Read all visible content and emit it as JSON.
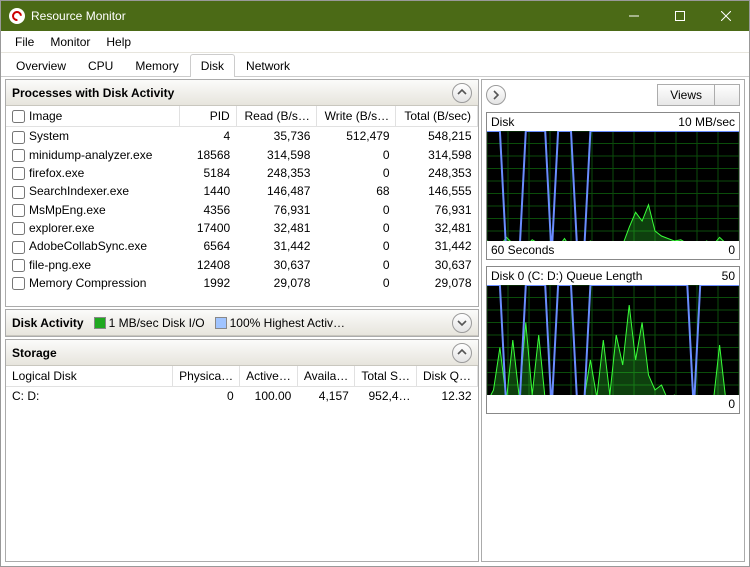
{
  "window": {
    "title": "Resource Monitor"
  },
  "menu": [
    "File",
    "Monitor",
    "Help"
  ],
  "tabs": {
    "items": [
      "Overview",
      "CPU",
      "Memory",
      "Disk",
      "Network"
    ],
    "active": 3
  },
  "panels": {
    "processes": {
      "title": "Processes with Disk Activity",
      "columns": [
        "Image",
        "PID",
        "Read (B/s…",
        "Write (B/s…",
        "Total (B/sec)"
      ],
      "rows": [
        {
          "image": "System",
          "pid": "4",
          "read": "35,736",
          "write": "512,479",
          "total": "548,215"
        },
        {
          "image": "minidump-analyzer.exe",
          "pid": "18568",
          "read": "314,598",
          "write": "0",
          "total": "314,598"
        },
        {
          "image": "firefox.exe",
          "pid": "5184",
          "read": "248,353",
          "write": "0",
          "total": "248,353"
        },
        {
          "image": "SearchIndexer.exe",
          "pid": "1440",
          "read": "146,487",
          "write": "68",
          "total": "146,555"
        },
        {
          "image": "MsMpEng.exe",
          "pid": "4356",
          "read": "76,931",
          "write": "0",
          "total": "76,931"
        },
        {
          "image": "explorer.exe",
          "pid": "17400",
          "read": "32,481",
          "write": "0",
          "total": "32,481"
        },
        {
          "image": "AdobeCollabSync.exe",
          "pid": "6564",
          "read": "31,442",
          "write": "0",
          "total": "31,442"
        },
        {
          "image": "file-png.exe",
          "pid": "12408",
          "read": "30,637",
          "write": "0",
          "total": "30,637"
        },
        {
          "image": "Memory Compression",
          "pid": "1992",
          "read": "29,078",
          "write": "0",
          "total": "29,078"
        }
      ]
    },
    "activity": {
      "title": "Disk Activity",
      "legend1_color": "#1fa81f",
      "legend1_text": "1 MB/sec Disk I/O",
      "legend2_color": "#a0c4ff",
      "legend2_text": "100% Highest Active T…"
    },
    "storage": {
      "title": "Storage",
      "columns": [
        "Logical Disk",
        "Physica…",
        "Active…",
        "Availa…",
        "Total S…",
        "Disk Q…"
      ],
      "rows": [
        {
          "c0": "C: D:",
          "c1": "0",
          "c2": "100.00",
          "c3": "4,157",
          "c4": "952,4…",
          "c5": "12.32"
        }
      ]
    }
  },
  "right": {
    "views_label": "Views",
    "charts": [
      {
        "title": "Disk",
        "right": "10 MB/sec",
        "foot_left": "60 Seconds",
        "foot_right": "0",
        "height": 125
      },
      {
        "title": "Disk 0 (C: D:) Queue Length",
        "right": "50",
        "foot_left": "",
        "foot_right": "0",
        "height": 125
      }
    ]
  },
  "chart_data": [
    {
      "type": "line",
      "title": "Disk",
      "ylabel": "MB/sec",
      "ylim": [
        0,
        10
      ],
      "xlim_seconds": [
        60,
        0
      ],
      "series": [
        {
          "name": "Disk I/O",
          "color": "#39ff39",
          "values": [
            1.2,
            1.0,
            0.8,
            1.5,
            1.0,
            0.6,
            0.8,
            1.3,
            1.0,
            0.8,
            1.0,
            0.7,
            1.4,
            0.6,
            0.7,
            0.9,
            1.2,
            0.8,
            1.0,
            0.6,
            0.7,
            0.9,
            2.3,
            3.5,
            2.8,
            4.1,
            2.0,
            1.6,
            1.4,
            1.2,
            1.3,
            1.0,
            1.1,
            0.9,
            1.2,
            0.9,
            1.5,
            1.0,
            0.8,
            0.6
          ]
        },
        {
          "name": "Highest Active Time %",
          "color": "#6a8dff",
          "ylim": [
            0,
            100
          ],
          "values": [
            100,
            100,
            100,
            0,
            0,
            0,
            100,
            100,
            100,
            100,
            0,
            100,
            100,
            100,
            0,
            0,
            100,
            100,
            100,
            100,
            100,
            100,
            100,
            100,
            100,
            100,
            100,
            100,
            100,
            100,
            100,
            100,
            100,
            100,
            100,
            100,
            100,
            100,
            100,
            100
          ]
        }
      ]
    },
    {
      "type": "line",
      "title": "Disk 0 (C: D:) Queue Length",
      "ylim": [
        0,
        50
      ],
      "xlim_seconds": [
        60,
        0
      ],
      "series": [
        {
          "name": "Queue Length",
          "color": "#39ff39",
          "values": [
            3,
            8,
            25,
            4,
            28,
            5,
            35,
            6,
            30,
            4,
            2,
            3,
            5,
            4,
            2,
            4,
            20,
            5,
            28,
            6,
            30,
            18,
            42,
            20,
            35,
            14,
            8,
            10,
            4,
            6,
            3,
            2,
            5,
            4,
            2,
            3,
            26,
            3,
            2,
            1
          ]
        },
        {
          "name": "Active",
          "color": "#6a8dff",
          "values": [
            50,
            50,
            50,
            0,
            0,
            0,
            50,
            50,
            50,
            50,
            0,
            50,
            50,
            50,
            0,
            0,
            50,
            50,
            50,
            50,
            50,
            50,
            50,
            50,
            50,
            50,
            50,
            50,
            50,
            50,
            50,
            50,
            0,
            50,
            50,
            50,
            50,
            50,
            50,
            50
          ]
        }
      ]
    }
  ]
}
